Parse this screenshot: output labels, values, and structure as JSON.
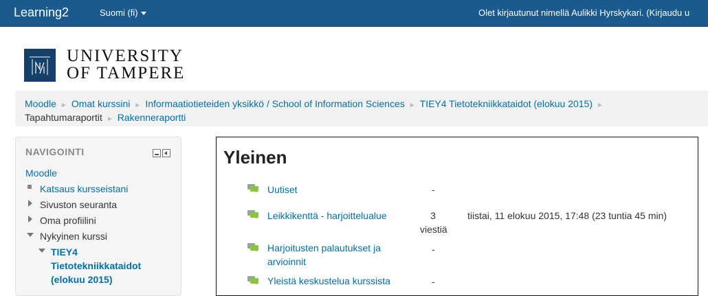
{
  "topbar": {
    "brand": "Learning2",
    "language": "Suomi (fi)",
    "login_text": "Olet kirjautunut nimellä Aulikki Hyrskykari. (Kirjaudu u"
  },
  "logo": {
    "line1": "UNIVERSITY",
    "line2": "OF TAMPERE"
  },
  "breadcrumb": {
    "items": [
      "Moodle",
      "Omat kurssini",
      "Informaatiotieteiden yksikkö / School of Information Sciences",
      "TIEY4 Tietotekniikkataidot (elokuu 2015)",
      "Tapahtumaraportit",
      "Rakenneraportti"
    ],
    "separator": "►"
  },
  "navigation": {
    "title": "NAVIGOINTI",
    "root": "Moodle",
    "items": [
      "Katsaus kursseistani",
      "Sivuston seuranta",
      "Oma profiilini",
      "Nykyinen kurssi"
    ],
    "course_lines": [
      "TIEY4",
      "Tietotekniikkataidot",
      "(elokuu 2015)"
    ]
  },
  "section": {
    "title": "Yleinen",
    "rows": [
      {
        "link": [
          "Uutiset"
        ],
        "count": "-",
        "date": ""
      },
      {
        "link": [
          "Leikkikenttä - harjoittelualue"
        ],
        "count_lines": [
          "3",
          "viestiä"
        ],
        "date": "tiistai, 11 elokuu 2015, 17:48 (23 tuntia 45 min)"
      },
      {
        "link": [
          "Harjoitusten palautukset ja",
          "arvioinnit"
        ],
        "count": "-",
        "date": ""
      },
      {
        "link": [
          "Yleistä keskustelua kurssista"
        ],
        "count": "-",
        "date": ""
      }
    ]
  },
  "colors": {
    "topbar": "#1a5a8f",
    "link": "#0070a8",
    "logo_mark": "#14406a",
    "forum_icon": "#8cc63f"
  },
  "icons": [
    "caret-down-icon",
    "forum-icon",
    "dock-icon",
    "collapse-icon"
  ]
}
